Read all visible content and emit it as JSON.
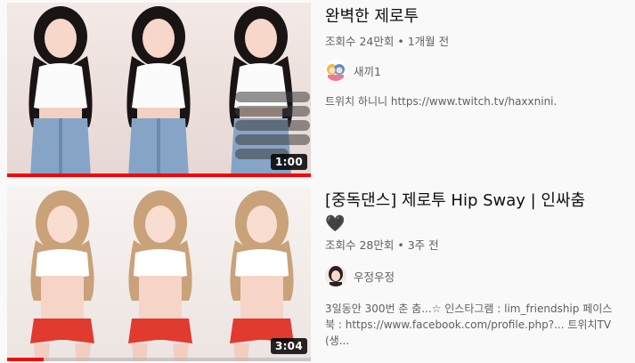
{
  "videos": [
    {
      "title": "완벽한 제로투",
      "views": "조회수 24만회",
      "age": "1개월 전",
      "channel": "새끼1",
      "description": "트위치 하니니 https://www.twitch.tv/haxxnini.",
      "duration": "1:00",
      "progress": 1.0
    },
    {
      "title": "[중독댄스] 제로투 Hip Sway | 인싸춤",
      "title_line2": "🖤",
      "views": "조회수 28만회",
      "age": "3주 전",
      "channel": "우정우정",
      "description_line1": "3일동안 300번 춘 춤...☆ 인스타그램 : lim_friendship 페이스",
      "description_line2": "북 : https://www.facebook.com/profile.php?... 트위치TV (생...",
      "duration": "3:04",
      "progress": 0.12
    }
  ],
  "separator": "•",
  "colors": {
    "progress": "#ff0000",
    "meta": "#606060",
    "title": "#0f0f0f"
  }
}
